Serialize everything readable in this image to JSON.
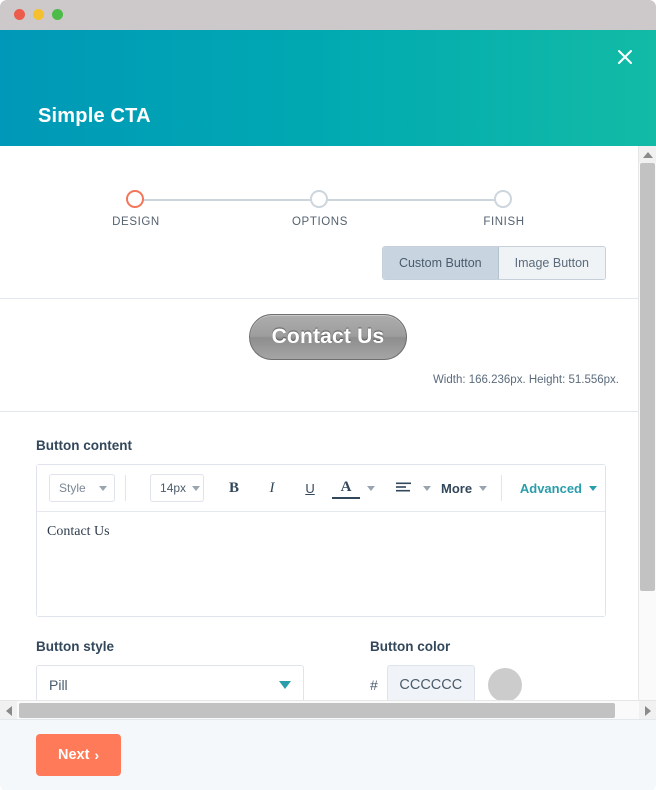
{
  "window": {
    "traffic_lights": [
      {
        "name": "close",
        "color": "#ec5b4c"
      },
      {
        "name": "minimize",
        "color": "#f5c02f"
      },
      {
        "name": "zoom",
        "color": "#4cbb47"
      }
    ]
  },
  "header": {
    "title": "Simple CTA",
    "close_icon": "close-icon",
    "gradient_from": "#0098B8",
    "gradient_to": "#12BBA5"
  },
  "stepper": {
    "steps": [
      {
        "label": "DESIGN",
        "active": true
      },
      {
        "label": "OPTIONS",
        "active": false
      },
      {
        "label": "FINISH",
        "active": false
      }
    ],
    "active_color": "#F2765A",
    "inactive_color": "#CDD5DD"
  },
  "button_type_toggle": {
    "options": [
      {
        "label": "Custom Button",
        "selected": true
      },
      {
        "label": "Image Button",
        "selected": false
      }
    ]
  },
  "preview": {
    "button_label": "Contact Us",
    "dimensions_text": "Width: 166.236px. Height: 51.556px.",
    "width_value": "166.236px",
    "height_value": "51.556px"
  },
  "button_content": {
    "label": "Button content",
    "toolbar": {
      "style_select": "Style",
      "size_select": "14px",
      "bold": "B",
      "italic": "I",
      "underline": "U",
      "font_color": "A",
      "align": "align-left-icon",
      "more": "More",
      "advanced": "Advanced",
      "accent_color": "#2A9DAB"
    },
    "editor_text": "Contact Us"
  },
  "button_style": {
    "label": "Button style",
    "value": "Pill"
  },
  "button_color": {
    "label": "Button color",
    "hash": "#",
    "value": "CCCCCC",
    "swatch_color": "#CCCCCC"
  },
  "scrollbars": {
    "vertical_up": "chevron-up-icon",
    "vertical_down": "chevron-down-icon",
    "horizontal_left": "chevron-left-icon",
    "horizontal_right": "chevron-right-icon"
  },
  "footer": {
    "next_label": "Next",
    "next_chevron": "›",
    "next_color": "#FF7A59"
  }
}
